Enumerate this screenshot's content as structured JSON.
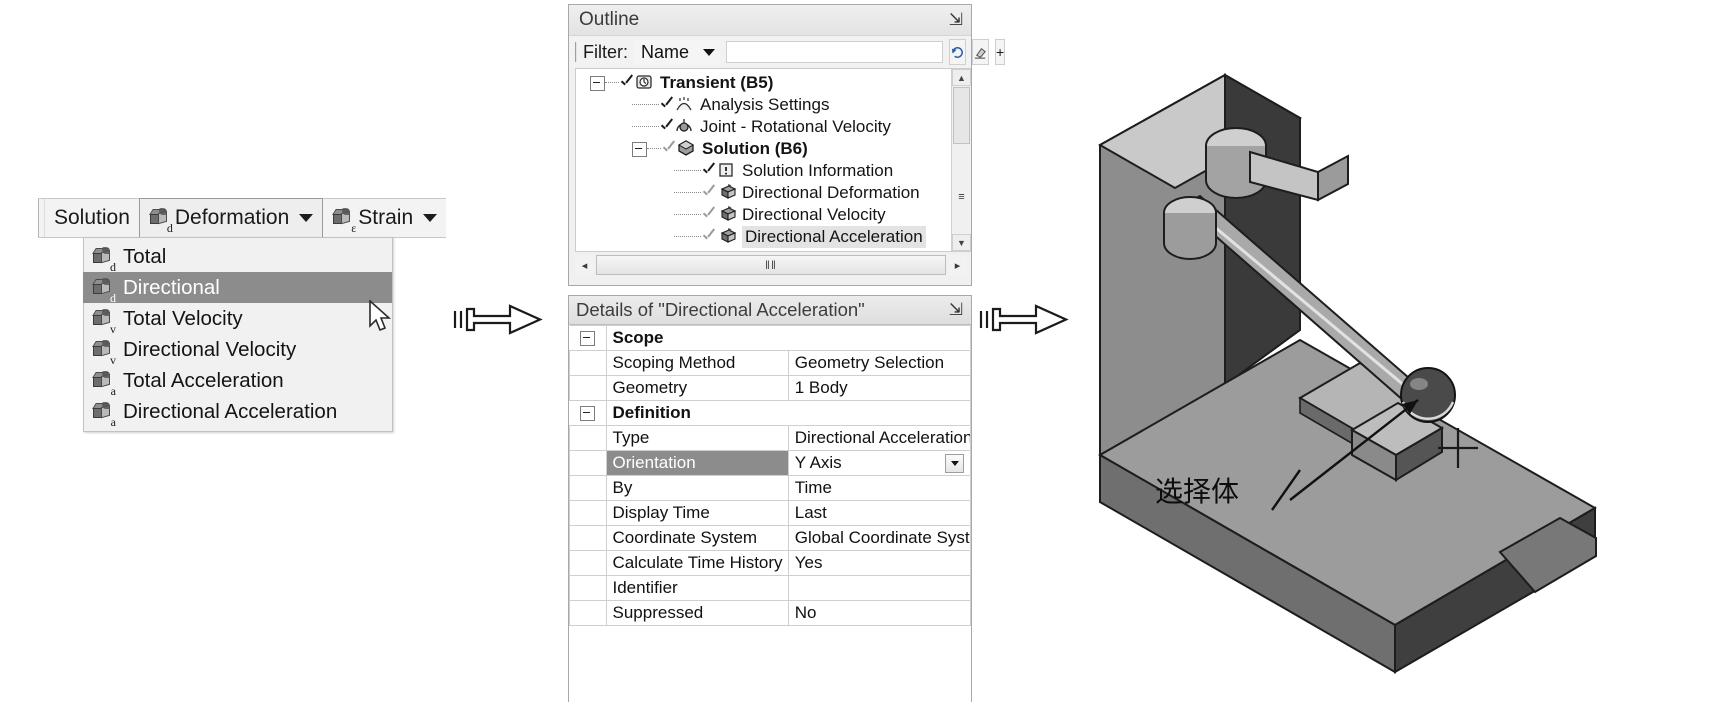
{
  "toolbar": {
    "solution_label": "Solution",
    "deformation_label": "Deformation",
    "strain_label": "Strain",
    "deformation_icon_sub": "d",
    "strain_icon_sub": "ε"
  },
  "deformation_menu": {
    "items": [
      {
        "label": "Total",
        "icon_sub": "d",
        "selected": false
      },
      {
        "label": "Directional",
        "icon_sub": "d",
        "selected": true
      },
      {
        "label": "Total Velocity",
        "icon_sub": "v",
        "selected": false
      },
      {
        "label": "Directional Velocity",
        "icon_sub": "v",
        "selected": false
      },
      {
        "label": "Total Acceleration",
        "icon_sub": "a",
        "selected": false
      },
      {
        "label": "Directional Acceleration",
        "icon_sub": "a",
        "selected": false
      }
    ]
  },
  "outline": {
    "title": "Outline",
    "pin_glyph": "⇲",
    "filter_label": "Filter:",
    "filter_value": "Name",
    "filter_input_value": "",
    "filter_input_placeholder": "",
    "refresh_glyph": "↻",
    "clear_glyph": "⊘",
    "expand_glyph": "+",
    "scroll_up_glyph": "▲",
    "scroll_down_glyph": "▼",
    "hscroll_left_glyph": "◂",
    "hscroll_right_glyph": "▸",
    "hscroll_grip": "‖‖",
    "vscroll_mid_glyph": "≡",
    "tree": [
      {
        "label": "Transient (B5)",
        "bold": true,
        "indent": 0,
        "icon": "clock-icon",
        "check": "check",
        "expander": true,
        "selected": false
      },
      {
        "label": "Analysis Settings",
        "bold": false,
        "indent": 1,
        "icon": "analysis-settings-icon",
        "check": "check",
        "expander": false,
        "selected": false
      },
      {
        "label": "Joint - Rotational Velocity",
        "bold": false,
        "indent": 1,
        "icon": "joint-icon",
        "check": "check",
        "expander": false,
        "selected": false
      },
      {
        "label": "Solution (B6)",
        "bold": true,
        "indent": 1,
        "icon": "solution-icon",
        "check": "check-light",
        "expander": true,
        "selected": false
      },
      {
        "label": "Solution Information",
        "bold": false,
        "indent": 2,
        "icon": "solution-info-icon",
        "check": "check",
        "expander": false,
        "selected": false
      },
      {
        "label": "Directional Deformation",
        "bold": false,
        "indent": 2,
        "icon": "result-cube-icon",
        "check": "check-light",
        "expander": false,
        "selected": false
      },
      {
        "label": "Directional Velocity",
        "bold": false,
        "indent": 2,
        "icon": "result-cube-icon",
        "check": "check-light",
        "expander": false,
        "selected": false
      },
      {
        "label": "Directional Acceleration",
        "bold": false,
        "indent": 2,
        "icon": "result-cube-icon",
        "check": "check-light",
        "expander": false,
        "selected": true
      }
    ]
  },
  "details": {
    "title": "Details of \"Directional Acceleration\"",
    "pin_glyph": "⇲",
    "rows": [
      {
        "kind": "group",
        "key": "Scope",
        "value": ""
      },
      {
        "kind": "row",
        "key": "Scoping Method",
        "value": "Geometry Selection"
      },
      {
        "kind": "row",
        "key": "Geometry",
        "value": "1 Body"
      },
      {
        "kind": "group",
        "key": "Definition",
        "value": ""
      },
      {
        "kind": "row",
        "key": "Type",
        "value": "Directional Acceleration"
      },
      {
        "kind": "row-combo",
        "key": "Orientation",
        "value": "Y Axis",
        "highlight": true
      },
      {
        "kind": "row",
        "key": "By",
        "value": "Time"
      },
      {
        "kind": "row",
        "key": "Display Time",
        "value": "Last"
      },
      {
        "kind": "row",
        "key": "Coordinate System",
        "value": "Global Coordinate System"
      },
      {
        "kind": "row",
        "key": "Calculate Time History",
        "value": "Yes"
      },
      {
        "kind": "row",
        "key": "Identifier",
        "value": ""
      },
      {
        "kind": "row",
        "key": "Suppressed",
        "value": "No"
      }
    ]
  },
  "viewport": {
    "annotation": "选择体"
  },
  "colors": {
    "selection_highlight": "#8c8c8c",
    "panel_bg": "#f0f0f0",
    "tree_selected_bg": "#e3e3e3",
    "model_dark": "#3a3a3a",
    "model_mid": "#8d8d8d",
    "model_light": "#c9c9c9"
  }
}
